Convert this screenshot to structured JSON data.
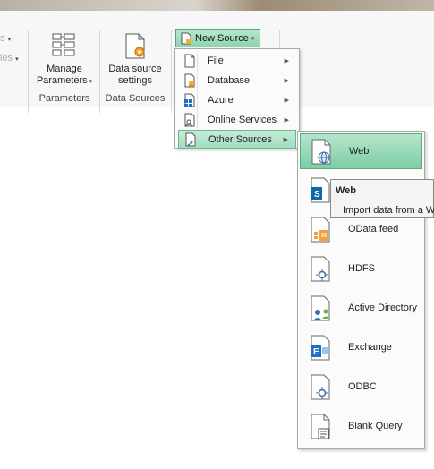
{
  "ribbon": {
    "faded_items": [
      "s",
      "ies"
    ],
    "manage_parameters": {
      "line1": "Manage",
      "line2": "Parameters"
    },
    "data_source_settings": {
      "line1": "Data source",
      "line2": "settings"
    },
    "groups": {
      "parameters": "Parameters",
      "data_sources": "Data Sources"
    },
    "new_source": {
      "label": "New Source"
    }
  },
  "new_source_menu": {
    "items": [
      {
        "label": "File",
        "icon": "file-icon"
      },
      {
        "label": "Database",
        "icon": "database-icon"
      },
      {
        "label": "Azure",
        "icon": "azure-icon"
      },
      {
        "label": "Online Services",
        "icon": "online-services-icon"
      },
      {
        "label": "Other Sources",
        "icon": "other-sources-icon",
        "active": true
      }
    ]
  },
  "other_sources_menu": {
    "items": [
      {
        "label": "Web",
        "icon": "web-icon",
        "active": true
      },
      {
        "label": "",
        "icon": "sharepoint-icon"
      },
      {
        "label": "OData feed",
        "icon": "odata-icon"
      },
      {
        "label": "HDFS",
        "icon": "hdfs-icon"
      },
      {
        "label": "Active Directory",
        "icon": "active-directory-icon"
      },
      {
        "label": "Exchange",
        "icon": "exchange-icon"
      },
      {
        "label": "ODBC",
        "icon": "odbc-icon"
      },
      {
        "label": "Blank Query",
        "icon": "blank-query-icon"
      }
    ]
  },
  "tooltip": {
    "title": "Web",
    "body": "Import data from a W"
  },
  "colors": {
    "accent_green": "#8ed3b0",
    "highlight_green": "#7dcda4"
  }
}
